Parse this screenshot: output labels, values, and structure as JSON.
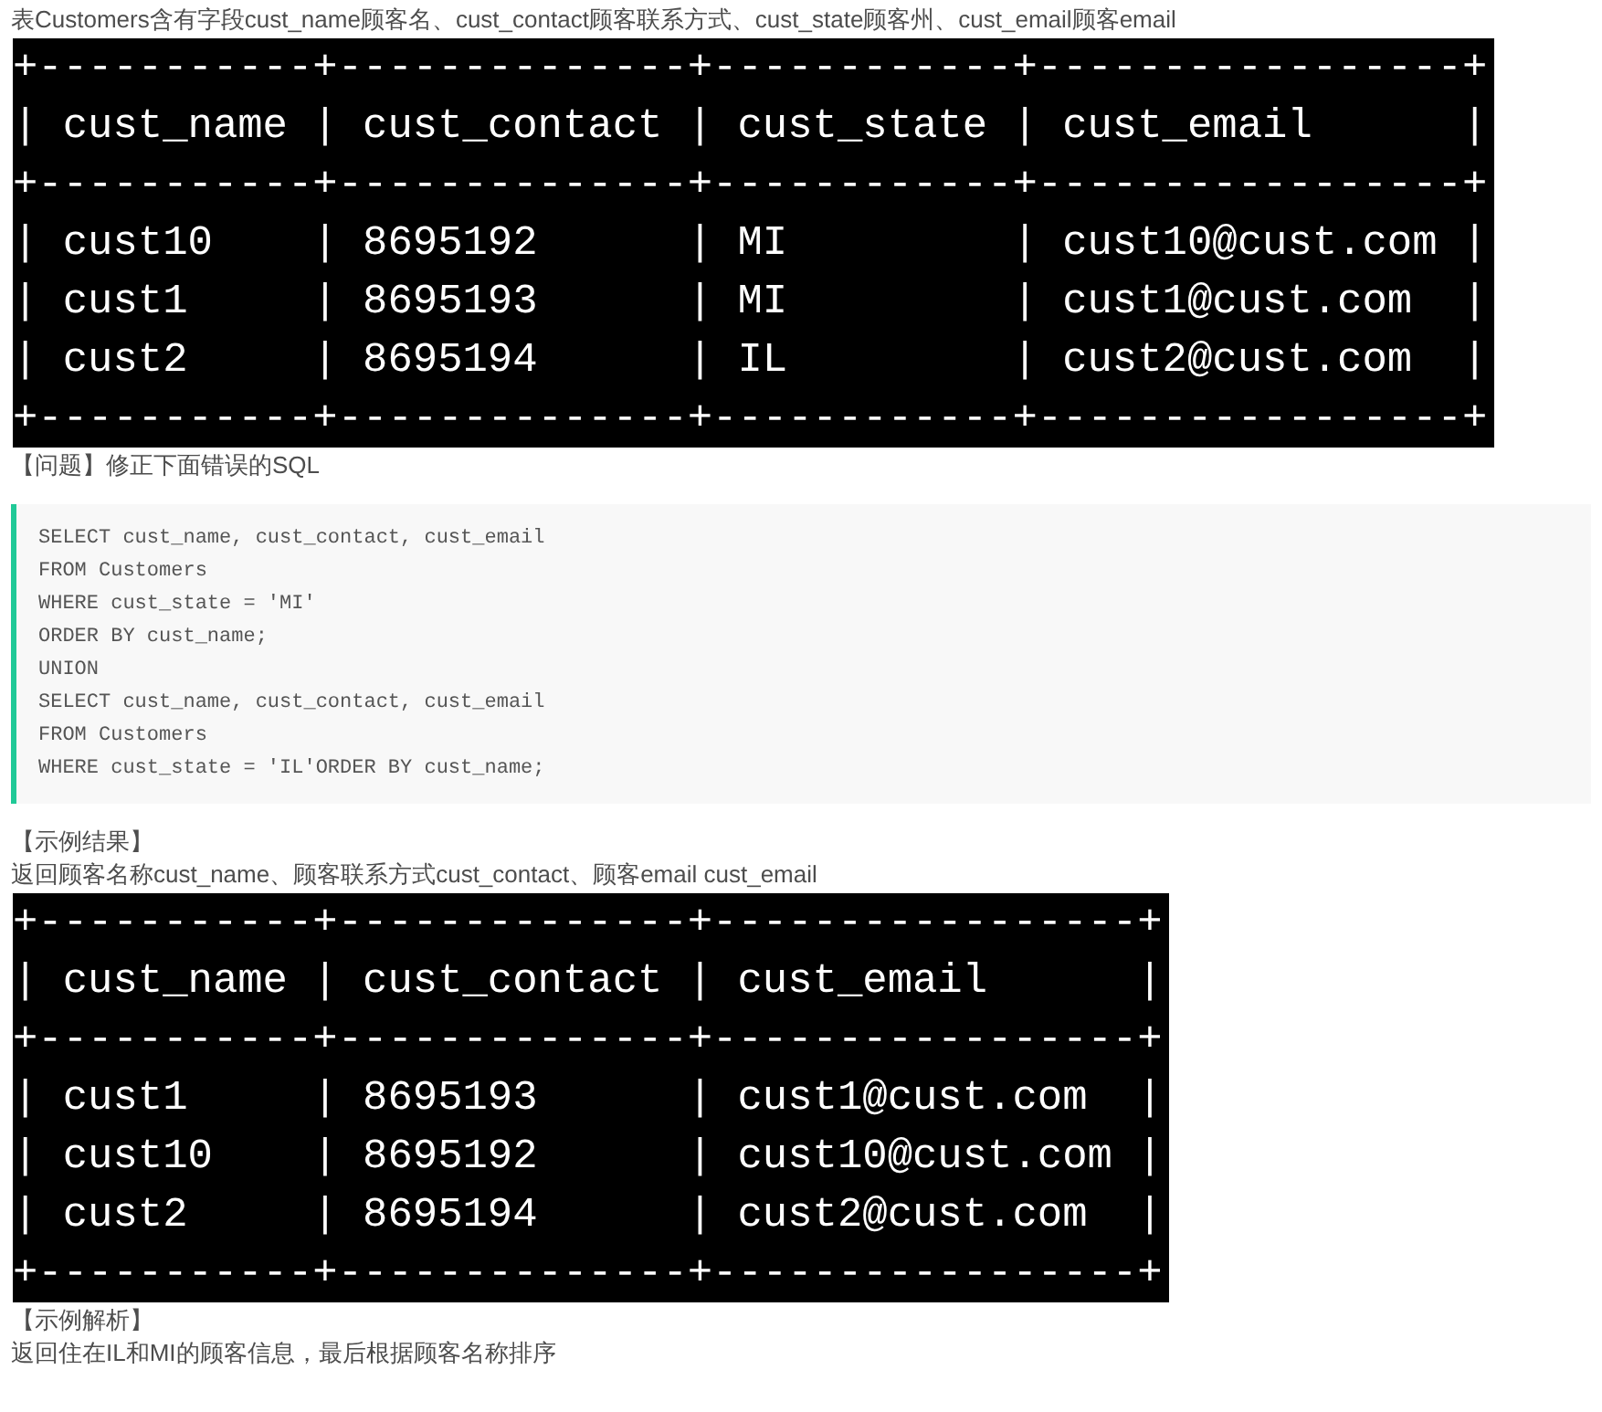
{
  "blocks": [
    {
      "kind": "text",
      "text": "表Customers含有字段cust_name顾客名、cust_contact顾客联系方式、cust_state顾客州、cust_email顾客email"
    },
    {
      "kind": "terminal",
      "lines": [
        "+-----------+--------------+------------+-----------------+",
        "| cust_name | cust_contact | cust_state | cust_email      |",
        "+-----------+--------------+------------+-----------------+",
        "| cust10    | 8695192      | MI         | cust10@cust.com |",
        "| cust1     | 8695193      | MI         | cust1@cust.com  |",
        "| cust2     | 8695194      | IL         | cust2@cust.com  |",
        "+-----------+--------------+------------+-----------------+"
      ]
    },
    {
      "kind": "text",
      "text": "【问题】修正下面错误的SQL"
    },
    {
      "kind": "code",
      "lines": [
        "SELECT cust_name, cust_contact, cust_email",
        "FROM Customers",
        "WHERE cust_state = 'MI'",
        "ORDER BY cust_name;",
        "UNION",
        "SELECT cust_name, cust_contact, cust_email",
        "FROM Customers",
        "WHERE cust_state = 'IL'ORDER BY cust_name;"
      ]
    },
    {
      "kind": "text",
      "text": "【示例结果】"
    },
    {
      "kind": "text",
      "text": "返回顾客名称cust_name、顾客联系方式cust_contact、顾客email cust_email"
    },
    {
      "kind": "terminal",
      "lines": [
        "+-----------+--------------+-----------------+",
        "| cust_name | cust_contact | cust_email      |",
        "+-----------+--------------+-----------------+",
        "| cust1     | 8695193      | cust1@cust.com  |",
        "| cust10    | 8695192      | cust10@cust.com |",
        "| cust2     | 8695194      | cust2@cust.com  |",
        "+-----------+--------------+-----------------+"
      ]
    },
    {
      "kind": "text",
      "text": "【示例解析】"
    },
    {
      "kind": "text",
      "text": "返回住在IL和MI的顾客信息，最后根据顾客名称排序"
    }
  ]
}
